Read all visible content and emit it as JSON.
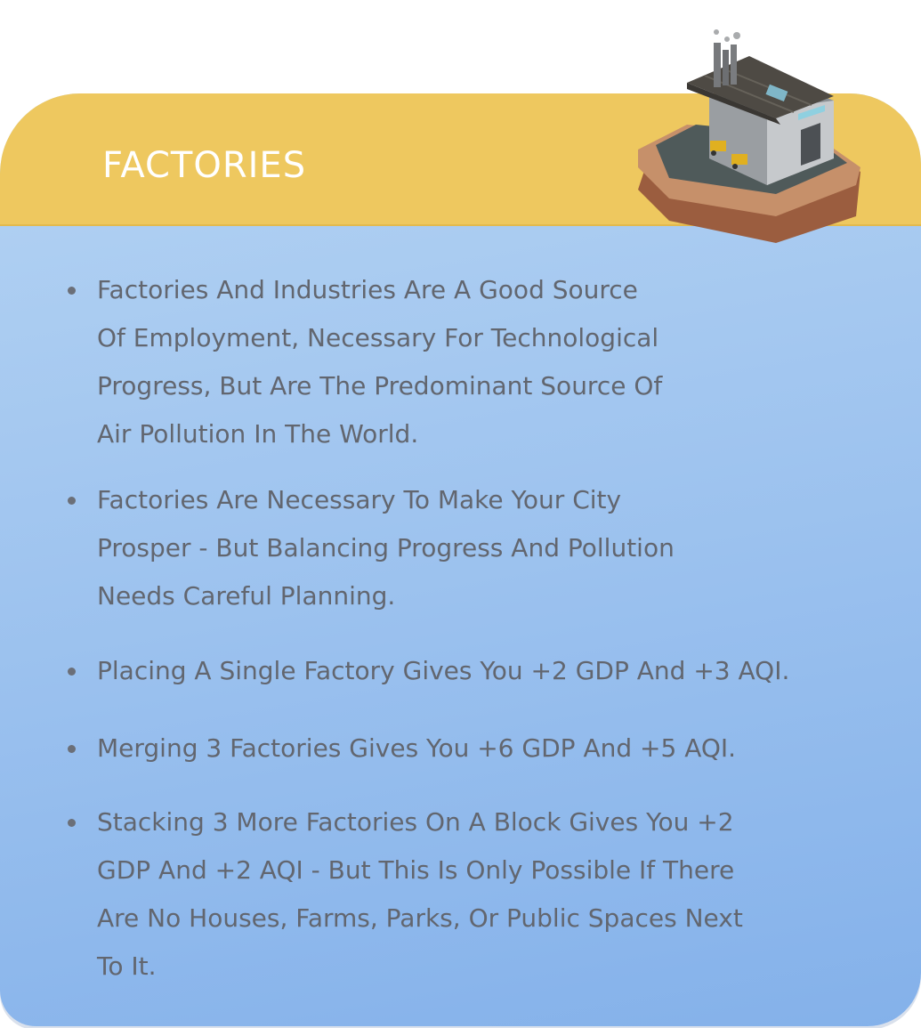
{
  "header": {
    "title": "FACTORIES",
    "icon": "factory-icon",
    "color": "#eec85f"
  },
  "body": {
    "background_top": "#b4d3f3",
    "background_bottom": "#84b1ea",
    "text_color": "#62666f",
    "bullets": [
      "Factories And Industries Are A Good Source\nOf Employment, Necessary For Technological\nProgress, But Are The Predominant Source Of\nAir Pollution In The World.",
      "Factories Are Necessary To Make Your City\nProsper - But Balancing Progress And Pollution\nNeeds Careful Planning.",
      "Placing A Single Factory Gives You +2 GDP And +3 AQI.",
      "Merging 3 Factories Gives You +6 GDP And +5 AQI.",
      "Stacking 3 More Factories On A Block Gives You +2\nGDP And +2 AQI - But This Is Only Possible If There\nAre No Houses, Farms, Parks, Or Public Spaces Next\nTo It."
    ]
  }
}
